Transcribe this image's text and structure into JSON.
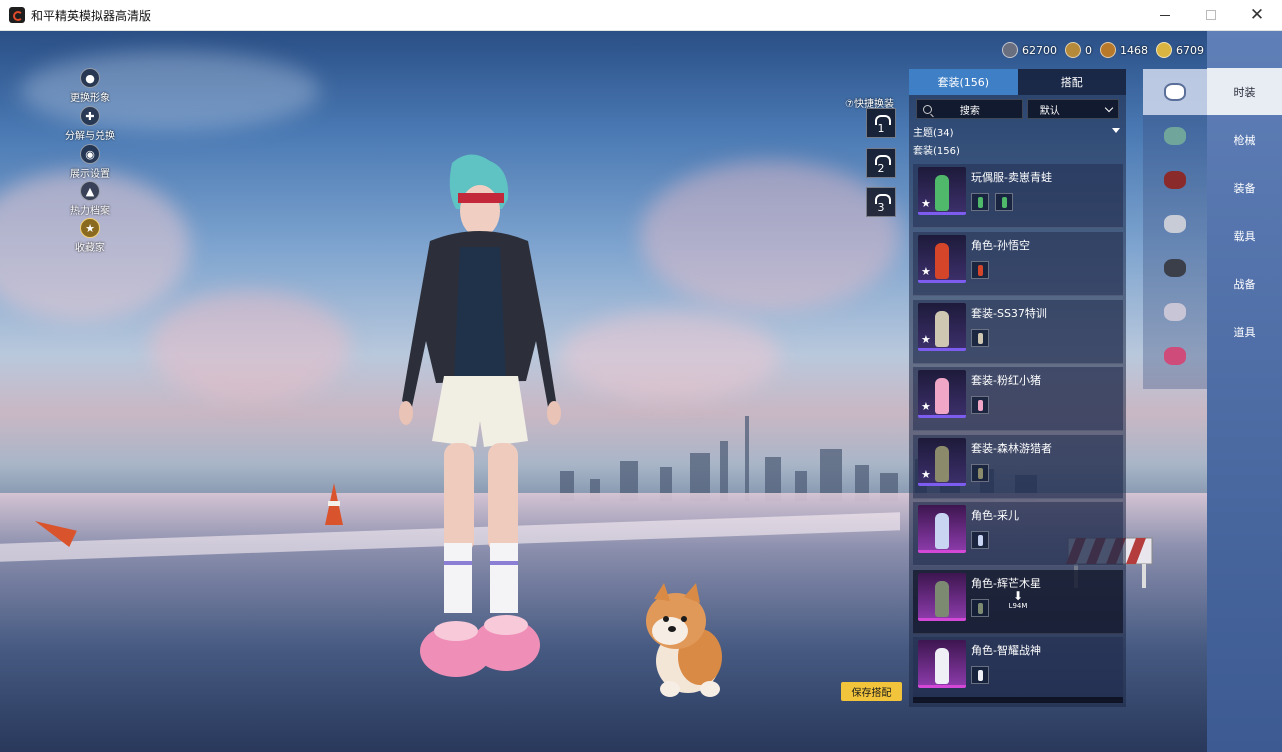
{
  "window": {
    "title": "和平精英模拟器高清版",
    "minimize_icon": "minimize-icon",
    "maximize_icon": "maximize-icon",
    "close_symbol": "✕"
  },
  "left_menu": [
    {
      "label": "更换形象",
      "icon": "avatar-icon"
    },
    {
      "label": "分解与兑换",
      "icon": "puzzle-icon"
    },
    {
      "label": "展示设置",
      "icon": "eye-icon"
    },
    {
      "label": "热力档案",
      "icon": "flame-icon"
    },
    {
      "label": "收藏家",
      "icon": "collector-badge-icon"
    }
  ],
  "currency": [
    {
      "value": "62700",
      "color": "#6a6f80"
    },
    {
      "value": "0",
      "color": "#b58a3a"
    },
    {
      "value": "1468",
      "color": "#b87a2a"
    },
    {
      "value": "6709",
      "color": "#d9b441"
    }
  ],
  "top_close_symbol": "✕",
  "quick_switch": {
    "label": "⑦快捷换装",
    "slots": [
      "1",
      "2",
      "3"
    ]
  },
  "panel": {
    "tabs": [
      {
        "label": "套装(156)",
        "active": true
      },
      {
        "label": "搭配",
        "active": false
      }
    ],
    "search_placeholder": "搜索",
    "sort_value": "默认",
    "theme_label": "主题(34)",
    "sets_label": "套装(156)",
    "items": [
      {
        "name": "玩偶服-卖崽青蛙",
        "rarity": "epic",
        "sub_count": 2,
        "fig_color": "#4fb86a",
        "starred": true
      },
      {
        "name": "角色-孙悟空",
        "rarity": "epic",
        "sub_count": 1,
        "fig_color": "#d4452a",
        "starred": true
      },
      {
        "name": "套装-SS37特训",
        "rarity": "epic",
        "sub_count": 1,
        "fig_color": "#cfc7b2",
        "starred": true
      },
      {
        "name": "套装-粉红小猪",
        "rarity": "epic",
        "sub_count": 1,
        "fig_color": "#f0a6c6",
        "starred": true
      },
      {
        "name": "套装-森林游猎者",
        "rarity": "epic",
        "sub_count": 1,
        "fig_color": "#8b8a6a",
        "starred": true
      },
      {
        "name": "角色-采儿",
        "rarity": "legend",
        "sub_count": 1,
        "fig_color": "#c9d3f2",
        "starred": false
      },
      {
        "name": "角色-辉芒木星",
        "rarity": "legend",
        "sub_count": 1,
        "fig_color": "#7d8a72",
        "starred": false,
        "downloading": true,
        "download_size": "L94M"
      },
      {
        "name": "角色-智耀战神",
        "rarity": "legend",
        "sub_count": 1,
        "fig_color": "#eef0f6",
        "starred": false
      }
    ]
  },
  "save_button": "保存搭配",
  "categories": [
    {
      "icon": "outfit-icon",
      "active": true,
      "color": "#e6ebf5"
    },
    {
      "icon": "helmet-icon",
      "active": false,
      "color": "#6fa59a"
    },
    {
      "icon": "hat-icon",
      "active": false,
      "color": "#8a2a2a"
    },
    {
      "icon": "mask-icon",
      "active": false,
      "color": "#c7ccd6"
    },
    {
      "icon": "backpack-icon",
      "active": false,
      "color": "#3a3f4a"
    },
    {
      "icon": "pants-icon",
      "active": false,
      "color": "#c8c5d6"
    },
    {
      "icon": "shoes-icon",
      "active": false,
      "color": "#cf4b7a"
    }
  ],
  "right_nav": [
    {
      "label": "时装",
      "active": true
    },
    {
      "label": "枪械",
      "active": false
    },
    {
      "label": "装备",
      "active": false
    },
    {
      "label": "载具",
      "active": false
    },
    {
      "label": "战备",
      "active": false
    },
    {
      "label": "道具",
      "active": false
    }
  ],
  "colors": {
    "accent_tab": "#3f7fc6",
    "save_button": "#f2c43b",
    "epic_border": "#7d5cf0",
    "legend_border": "#d448d8"
  }
}
